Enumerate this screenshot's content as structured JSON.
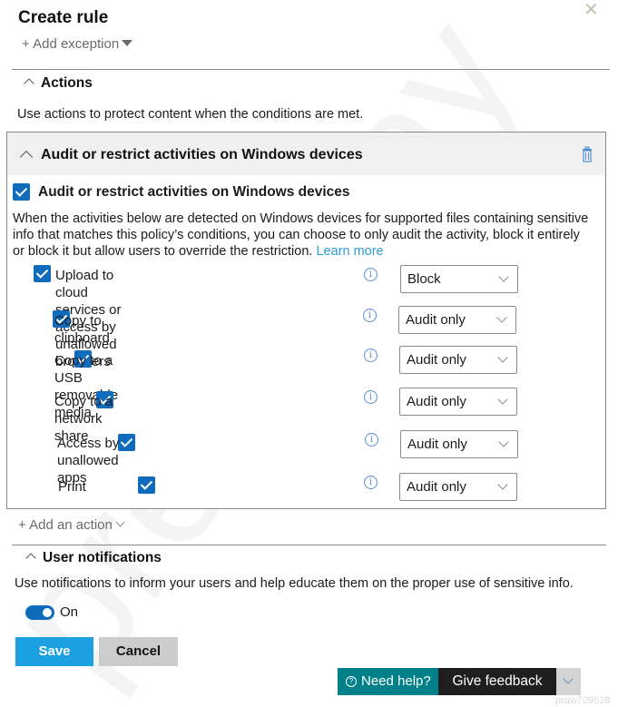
{
  "dialog": {
    "title": "Create rule",
    "add_exception_label": "+ Add exception"
  },
  "actions_section": {
    "heading": "Actions",
    "description": "Use actions to protect content when the conditions are met.",
    "card": {
      "header_title": "Audit or restrict activities on Windows devices",
      "checkbox_label": "Audit or restrict activities on Windows devices",
      "checkbox_checked": true,
      "paragraph": "When the activities below are detected on Windows devices for supported files containing sensitive info that matches this policy’s conditions, you can choose to only audit the activity, block it entirely or block it but allow users to override the restriction.",
      "learn_more": "Learn more",
      "activities": [
        {
          "label_line1": "Upload to cloud services or access by unallowed",
          "label_line2": "browsers",
          "checked": true,
          "value": "Block"
        },
        {
          "label_line1": "Copy to clipboard",
          "label_line2": "",
          "checked": true,
          "value": "Audit only"
        },
        {
          "label_line1": "Copy to a USB removable media",
          "label_line2": "",
          "checked": true,
          "value": "Audit only"
        },
        {
          "label_line1": "Copy to a network share",
          "label_line2": "",
          "checked": true,
          "value": "Audit only"
        },
        {
          "label_line1": "Access by unallowed apps",
          "label_line2": "",
          "checked": true,
          "value": "Audit only"
        },
        {
          "label_line1": "Print",
          "label_line2": "",
          "checked": true,
          "value": "Audit only"
        }
      ]
    },
    "add_action_label": "+ Add an action"
  },
  "user_notifications": {
    "heading": "User notifications",
    "description": "Use notifications to inform your users and help educate them on the proper use of sensitive info.",
    "toggle_on": true,
    "toggle_label": "On"
  },
  "footer": {
    "save_label": "Save",
    "cancel_label": "Cancel",
    "need_help_label": "Need help?",
    "give_feedback_label": "Give feedback"
  },
  "watermark": {
    "text": "prepaway",
    "id": "praw709528"
  },
  "colors": {
    "accent": "#0f6cbd",
    "save_button": "#1ba1e2",
    "help_bar": "#00818a",
    "link": "#2a9bd6"
  }
}
